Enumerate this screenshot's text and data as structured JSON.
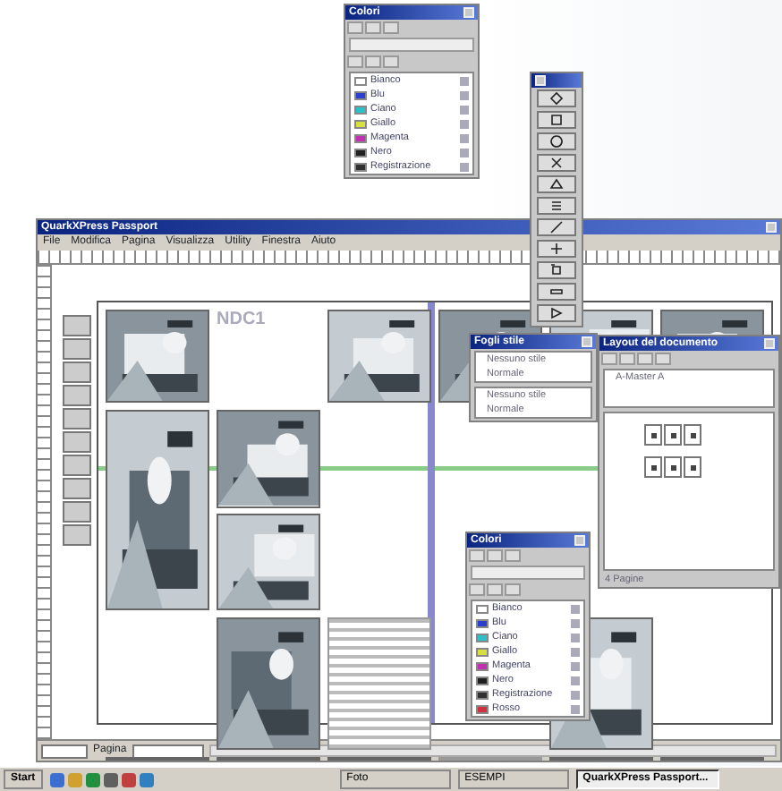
{
  "colors_palette": {
    "title": "Colori",
    "swatches": [
      {
        "name": "Bianco",
        "color": "#ffffff"
      },
      {
        "name": "Blu",
        "color": "#2a3fd0"
      },
      {
        "name": "Ciano",
        "color": "#2cc0c8"
      },
      {
        "name": "Giallo",
        "color": "#d8e040"
      },
      {
        "name": "Magenta",
        "color": "#c030b0"
      },
      {
        "name": "Nero",
        "color": "#202020"
      },
      {
        "name": "Registrazione",
        "color": "#303030"
      }
    ]
  },
  "window": {
    "title": "QuarkXPress Passport",
    "menu": [
      "File",
      "Modifica",
      "Pagina",
      "Visualizza",
      "Utility",
      "Finestra",
      "Aiuto"
    ]
  },
  "document": {
    "heading": "NDC1"
  },
  "style_palette": {
    "title": "Fogli stile",
    "paragraph_styles": [
      "Nessuno stile",
      "Normale"
    ],
    "character_styles": [
      "Nessuno stile",
      "Normale"
    ]
  },
  "layout_palette": {
    "title": "Layout del documento",
    "master": "A-Master A",
    "footer": "4 Pagine"
  },
  "colors_palette_2": {
    "title": "Colori",
    "swatches": [
      {
        "name": "Bianco",
        "color": "#ffffff"
      },
      {
        "name": "Blu",
        "color": "#2a3fd0"
      },
      {
        "name": "Ciano",
        "color": "#2cc0c8"
      },
      {
        "name": "Giallo",
        "color": "#d8e040"
      },
      {
        "name": "Magenta",
        "color": "#c030b0"
      },
      {
        "name": "Nero",
        "color": "#202020"
      },
      {
        "name": "Registrazione",
        "color": "#303030"
      },
      {
        "name": "Rosso",
        "color": "#d03040"
      }
    ]
  },
  "status_bar": {
    "page_label": "Pagina"
  },
  "taskbar": {
    "start": "Start",
    "tasks": [
      {
        "label": "Foto",
        "selected": false
      },
      {
        "label": "ESEMPI",
        "selected": false
      },
      {
        "label": "QuarkXPress Passport...",
        "selected": true
      }
    ]
  }
}
